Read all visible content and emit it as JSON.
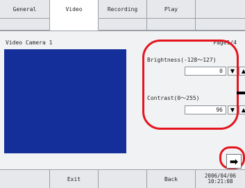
{
  "tabs": {
    "row1": [
      "General",
      "Video",
      "Recording",
      "Play",
      ""
    ],
    "active_index": 1
  },
  "panel": {
    "camera_title": "Video Camera 1",
    "page_indicator": "Page1/4",
    "video_color": "#142f99"
  },
  "brightness": {
    "label": "Brightness(-128～127)",
    "value": "0"
  },
  "contrast": {
    "label": "Contrast(0～255)",
    "value": "96"
  },
  "icons": {
    "down": "▼",
    "up": "▲",
    "next": "➡"
  },
  "bottom": {
    "exit_label": "Exit",
    "back_label": "Back",
    "date": "2006/04/06",
    "time": "10:21:08"
  },
  "colors": {
    "highlight": "#e5141d"
  }
}
